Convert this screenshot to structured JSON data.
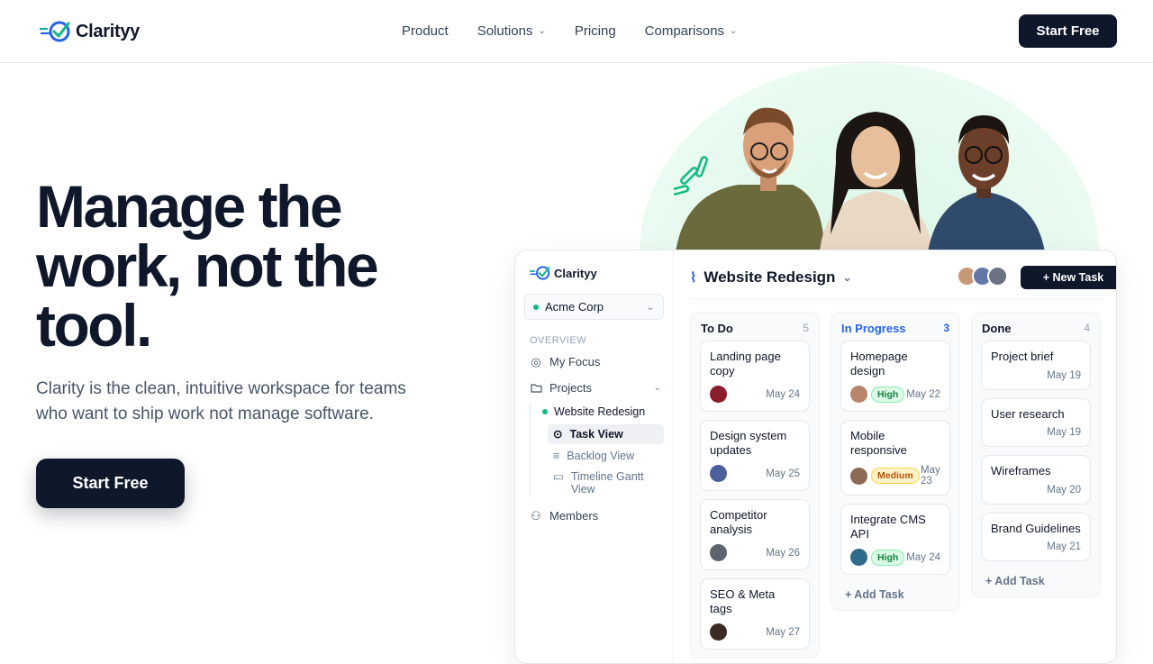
{
  "nav": {
    "brand": "Clarityy",
    "items": [
      {
        "label": "Product",
        "has_dropdown": false
      },
      {
        "label": "Solutions",
        "has_dropdown": true
      },
      {
        "label": "Pricing",
        "has_dropdown": false
      },
      {
        "label": "Comparisons",
        "has_dropdown": true
      }
    ],
    "cta": "Start Free"
  },
  "hero": {
    "title_line1": "Manage the",
    "title_line2": "work, not the",
    "title_line3": "tool.",
    "subtitle": "Clarity is the clean, intuitive workspace for teams who want to ship work not manage software.",
    "cta": "Start Free"
  },
  "app": {
    "brand": "Clarityy",
    "workspace": "Acme Corp",
    "section_label": "OVERVIEW",
    "my_focus": "My Focus",
    "projects": "Projects",
    "active_project": "Website Redesign",
    "views": [
      "Task View",
      "Backlog View",
      "Timeline Gantt View"
    ],
    "members": "Members",
    "board_title": "Website Redesign",
    "new_task": "+ New Task",
    "add_task": "+ Add Task",
    "columns": [
      {
        "title": "To Do",
        "count": "5",
        "color": "#0f172a",
        "cards": [
          {
            "title": "Landing page copy",
            "date": "May 24",
            "badge": ""
          },
          {
            "title": "Design system updates",
            "date": "May 25",
            "badge": ""
          },
          {
            "title": "Competitor analysis",
            "date": "May 26",
            "badge": ""
          },
          {
            "title": "SEO & Meta tags",
            "date": "May 27",
            "badge": ""
          }
        ]
      },
      {
        "title": "In Progress",
        "count": "3",
        "color": "#2563eb",
        "cards": [
          {
            "title": "Homepage design",
            "date": "May 22",
            "badge": "High"
          },
          {
            "title": "Mobile responsive",
            "date": "May 23",
            "badge": "Medium"
          },
          {
            "title": "Integrate CMS API",
            "date": "May 24",
            "badge": "High"
          }
        ]
      },
      {
        "title": "Done",
        "count": "4",
        "color": "#0f172a",
        "cards": [
          {
            "title": "Project brief",
            "date": "May 19",
            "badge": ""
          },
          {
            "title": "User research",
            "date": "May 19",
            "badge": ""
          },
          {
            "title": "Wireframes",
            "date": "May 20",
            "badge": ""
          },
          {
            "title": "Brand Guidelines",
            "date": "May 21",
            "badge": ""
          }
        ]
      }
    ]
  },
  "colors": {
    "brand_dark": "#0f172a",
    "brand_blue": "#2563eb",
    "brand_teal": "#10b981",
    "hero_blob": "#d8f5e4"
  }
}
